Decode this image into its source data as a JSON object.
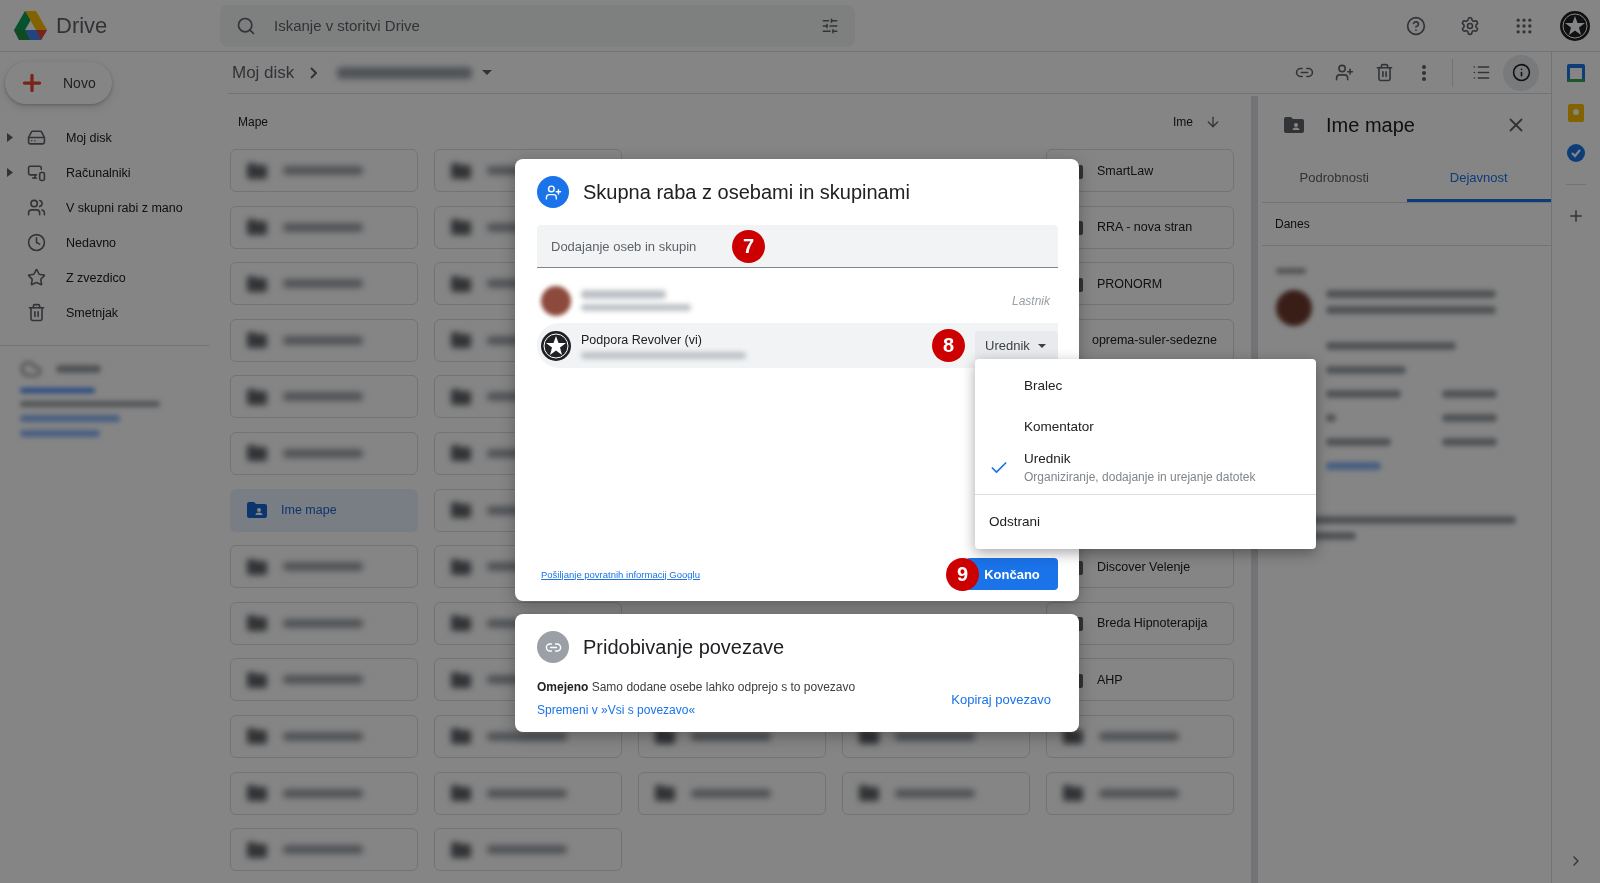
{
  "header": {
    "app_name": "Drive",
    "search_placeholder": "Iskanje v storitvi Drive"
  },
  "sidebar": {
    "new_button": "Novo",
    "items": [
      {
        "kind": "drive",
        "label": "Moj disk",
        "expandable": true
      },
      {
        "kind": "computers",
        "label": "Računalniki",
        "expandable": true
      },
      {
        "kind": "shared",
        "label": "V skupni rabi z mano",
        "expandable": false
      },
      {
        "kind": "recent",
        "label": "Nedavno",
        "expandable": false
      },
      {
        "kind": "starred",
        "label": "Z zvezdico",
        "expandable": false
      },
      {
        "kind": "trash",
        "label": "Smetnjak",
        "expandable": false
      }
    ]
  },
  "toolbar": {
    "breadcrumb": "Moj disk",
    "tools": [
      {
        "kind": "link",
        "selected": false
      },
      {
        "kind": "share",
        "selected": false
      },
      {
        "kind": "trash",
        "selected": false
      },
      {
        "kind": "more",
        "selected": false
      },
      {
        "kind": "list",
        "selected": false
      },
      {
        "kind": "info",
        "selected": true
      }
    ]
  },
  "content": {
    "section": "Mape",
    "sort": "Ime",
    "folder_rows": [
      [
        {
          "kind": "blurred"
        },
        {
          "kind": "blurred"
        },
        {
          "kind": "empty"
        },
        {
          "kind": "empty"
        },
        {
          "kind": "folder",
          "name": "SmartLaw",
          "selected": false
        }
      ],
      [
        {
          "kind": "blurred"
        },
        {
          "kind": "blurred"
        },
        {
          "kind": "empty"
        },
        {
          "kind": "empty"
        },
        {
          "kind": "folder",
          "name": "RRA - nova stran",
          "selected": false
        }
      ],
      [
        {
          "kind": "blurred"
        },
        {
          "kind": "blurred"
        },
        {
          "kind": "empty"
        },
        {
          "kind": "empty"
        },
        {
          "kind": "folder",
          "name": "PRONORM",
          "selected": false
        }
      ],
      [
        {
          "kind": "blurred"
        },
        {
          "kind": "blurred"
        },
        {
          "kind": "empty"
        },
        {
          "kind": "empty"
        },
        {
          "kind": "folder",
          "name": "oprema-suler-sedezne",
          "selected": false
        }
      ],
      [
        {
          "kind": "blurred"
        },
        {
          "kind": "blurred"
        },
        {
          "kind": "empty"
        },
        {
          "kind": "empty"
        },
        {
          "kind": "empty"
        }
      ],
      [
        {
          "kind": "blurred"
        },
        {
          "kind": "blurred"
        },
        {
          "kind": "empty"
        },
        {
          "kind": "empty"
        },
        {
          "kind": "empty"
        }
      ],
      [
        {
          "kind": "folder",
          "name": "Ime mape",
          "selected": true
        },
        {
          "kind": "blurred"
        },
        {
          "kind": "empty"
        },
        {
          "kind": "empty"
        },
        {
          "kind": "empty"
        }
      ],
      [
        {
          "kind": "blurred"
        },
        {
          "kind": "blurred"
        },
        {
          "kind": "empty"
        },
        {
          "kind": "empty"
        },
        {
          "kind": "folder",
          "name": "Discover Velenje",
          "selected": false
        }
      ],
      [
        {
          "kind": "blurred"
        },
        {
          "kind": "blurred"
        },
        {
          "kind": "empty"
        },
        {
          "kind": "empty"
        },
        {
          "kind": "folder",
          "name": "Breda Hipnoterapija",
          "selected": false
        }
      ],
      [
        {
          "kind": "blurred"
        },
        {
          "kind": "blurred"
        },
        {
          "kind": "empty"
        },
        {
          "kind": "empty"
        },
        {
          "kind": "folder",
          "name": "AHP",
          "selected": false
        }
      ],
      [
        {
          "kind": "blurred"
        },
        {
          "kind": "blurred"
        },
        {
          "kind": "blurred"
        },
        {
          "kind": "blurred"
        },
        {
          "kind": "blurred"
        }
      ],
      [
        {
          "kind": "blurred"
        },
        {
          "kind": "blurred"
        },
        {
          "kind": "blurred"
        },
        {
          "kind": "blurred"
        },
        {
          "kind": "blurred"
        }
      ],
      [
        {
          "kind": "blurred"
        },
        {
          "kind": "blurred"
        },
        {
          "kind": "empty"
        },
        {
          "kind": "empty"
        },
        {
          "kind": "empty"
        }
      ]
    ]
  },
  "details_panel": {
    "title": "Ime mape",
    "tabs": [
      {
        "label": "Podrobnosti",
        "selected": false
      },
      {
        "label": "Dejavnost",
        "selected": true
      }
    ],
    "day": "Danes"
  },
  "share_dialog": {
    "title": "Skupna raba z osebami in skupinami",
    "input_placeholder": "Dodajanje oseb in skupin",
    "input_callout": "7",
    "owner": {
      "role": "Lastnik"
    },
    "user": {
      "name": "Podpora Revolver (vi)",
      "role": "Urednik",
      "callout": "8"
    },
    "feedback_link": "Pošiljanje povratnih informacij Googlu",
    "done_button": "Končano",
    "done_callout": "9"
  },
  "link_card": {
    "title": "Pridobivanje povezave",
    "description": "**Omejeno** Samo dodane osebe lahko odprejo s to povezavo",
    "change_link": "Spremeni v »Vsi s povezavo«",
    "copy_link": "Kopiraj povezavo"
  },
  "role_menu": {
    "options": [
      {
        "label": "Bralec",
        "selected": false
      },
      {
        "label": "Komentator",
        "selected": false
      },
      {
        "label": "Urednik",
        "description": "Organiziranje, dodajanje in urejanje datotek",
        "selected": true
      }
    ],
    "remove": "Odstrani"
  }
}
